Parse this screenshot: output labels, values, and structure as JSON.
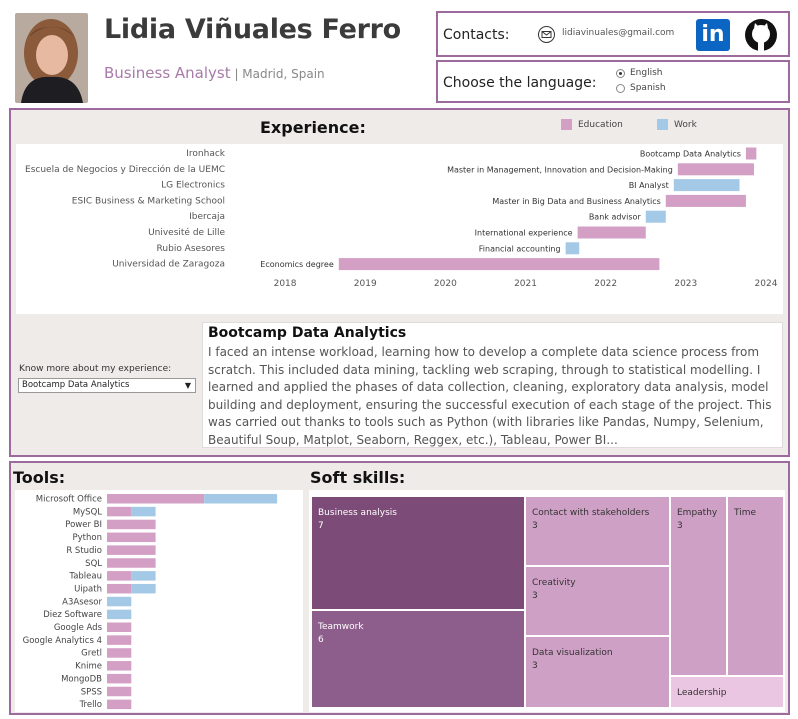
{
  "header": {
    "name": "Lidia Viñuales Ferro",
    "role": "Business Analyst",
    "location": " | Madrid, Spain"
  },
  "contacts": {
    "label": "Contacts:",
    "email": "lidiavinuales@gmail.com",
    "icons": [
      "email-icon",
      "linkedin-icon",
      "github-icon"
    ],
    "linkedin_text": "in"
  },
  "language": {
    "label": "Choose the language:",
    "options": [
      "English",
      "Spanish"
    ],
    "selected": "English"
  },
  "colors": {
    "education": "#d39fc4",
    "work": "#a3c9e6",
    "border": "#9c6a9c",
    "panel_bg": "#efebe8",
    "treemap_dark": "#7c4b78",
    "treemap_mid": "#8d5e8c",
    "treemap_light": "#cfa0c6",
    "treemap_lightest": "#ebc6e2"
  },
  "experience": {
    "title": "Experience:",
    "legend": [
      {
        "label": "Education",
        "color": "#d39fc4"
      },
      {
        "label": "Work",
        "color": "#a3c9e6"
      }
    ],
    "know_more_label": "Know more about my experience:",
    "selected": "Bootcamp Data Analytics",
    "description_title": "Bootcamp Data Analytics",
    "description": "I faced an intense workload, learning how to develop a complete data science process from scratch. This included data mining, tackling web scraping, through to statistical modelling. I learned and applied the phases of data collection, cleaning, exploratory data analysis, model building and deployment, ensuring the successful execution of each stage of the project. This was carried out thanks to tools such as Python (with libraries like Pandas, Numpy, Selenium, Beautiful Soup, Matplot, Seaborn, Reggex, etc.), Tableau, Power BI..."
  },
  "chart_data": [
    {
      "type": "bar",
      "subtype": "gantt",
      "x_range": [
        2017.5,
        2024.15
      ],
      "x_ticks": [
        "2018",
        "2019",
        "2020",
        "2021",
        "2022",
        "2023",
        "2024"
      ],
      "rows": [
        "Ironhack",
        "Escuela de Negocios y Dirección de la UEMC",
        "LG Electronics",
        "ESIC Business & Marketing School",
        "Ibercaja",
        "Univesité de Lille",
        "Rubio Asesores",
        "Universidad de Zaragoza"
      ],
      "bars": [
        {
          "row": 0,
          "label": "Bootcamp Data Analytics",
          "start": 2023.75,
          "end": 2023.88,
          "kind": "Education"
        },
        {
          "row": 1,
          "label": "Master in Management, Innovation and Decision-Making",
          "start": 2022.9,
          "end": 2023.85,
          "kind": "Education"
        },
        {
          "row": 2,
          "label": "BI Analyst",
          "start": 2022.85,
          "end": 2023.67,
          "kind": "Work"
        },
        {
          "row": 3,
          "label": "Master in Big Data and Business Analytics",
          "start": 2022.75,
          "end": 2023.75,
          "kind": "Education"
        },
        {
          "row": 4,
          "label": "Bank advisor",
          "start": 2022.5,
          "end": 2022.75,
          "kind": "Work"
        },
        {
          "row": 5,
          "label": "International experience",
          "start": 2021.65,
          "end": 2022.5,
          "kind": "Education"
        },
        {
          "row": 6,
          "label": "Financial accounting",
          "start": 2021.5,
          "end": 2021.67,
          "kind": "Work"
        },
        {
          "row": 7,
          "label": "Economics degree",
          "start": 2018.67,
          "end": 2022.67,
          "kind": "Education"
        }
      ]
    },
    {
      "type": "bar",
      "title": "Tools:",
      "categories": [
        "Microsoft Office",
        "MySQL",
        "Power BI",
        "Python",
        "R Studio",
        "SQL",
        "Tableau",
        "Uipath",
        "A3Asesor",
        "Diez Software",
        "Google Ads",
        "Google Analytics 4",
        "Gretl",
        "Knime",
        "MongoDB",
        "SPSS",
        "Trello"
      ],
      "series": [
        {
          "name": "Education",
          "values": [
            4,
            1,
            2,
            2,
            2,
            2,
            1,
            1,
            0,
            0,
            1,
            1,
            1,
            1,
            1,
            1,
            1
          ]
        },
        {
          "name": "Work",
          "values": [
            3,
            1,
            0,
            0,
            0,
            0,
            1,
            1,
            1,
            1,
            0,
            0,
            0,
            0,
            0,
            0,
            0
          ]
        }
      ]
    },
    {
      "type": "treemap",
      "title": "Soft skills:",
      "items": [
        {
          "label": "Business analysis",
          "value": 7
        },
        {
          "label": "Teamwork",
          "value": 6
        },
        {
          "label": "Contact with stakeholders",
          "value": 3
        },
        {
          "label": "Creativity",
          "value": 3
        },
        {
          "label": "Data visualization",
          "value": 3
        },
        {
          "label": "Empathy",
          "value": 3
        },
        {
          "label": "Time",
          "value": null
        },
        {
          "label": "Leadership",
          "value": null
        }
      ]
    }
  ]
}
